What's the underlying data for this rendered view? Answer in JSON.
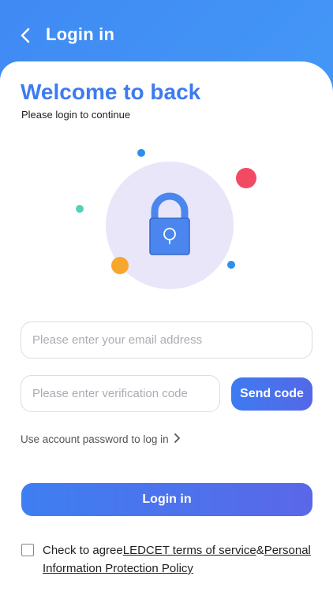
{
  "header": {
    "title": "Login in",
    "back_icon": "chevron-left-icon"
  },
  "welcome": {
    "title": "Welcome to back",
    "subtitle": "Please login to continue"
  },
  "illustration": {
    "icon": "lock-icon",
    "colors": {
      "circle": "#e8e6f8",
      "lock": "#4a86ee",
      "red_dot": "#f24a63",
      "orange_dot": "#f7a72e",
      "teal_dot": "#57d0b8",
      "blue_dot": "#2d8ef0"
    }
  },
  "form": {
    "email_placeholder": "Please enter your email address",
    "code_placeholder": "Please enter verification code",
    "send_code_label": "Send code",
    "alt_login_label": "Use account password to log in",
    "login_label": "Login in"
  },
  "agreement": {
    "prefix": "Check to agree",
    "terms_link": "LEDCET terms of service",
    "joiner": "&",
    "policy_link": "Personal Information Protection Policy",
    "checked": false
  },
  "colors": {
    "accent": "#3e7bf0",
    "header_bg": "#4192f5"
  }
}
